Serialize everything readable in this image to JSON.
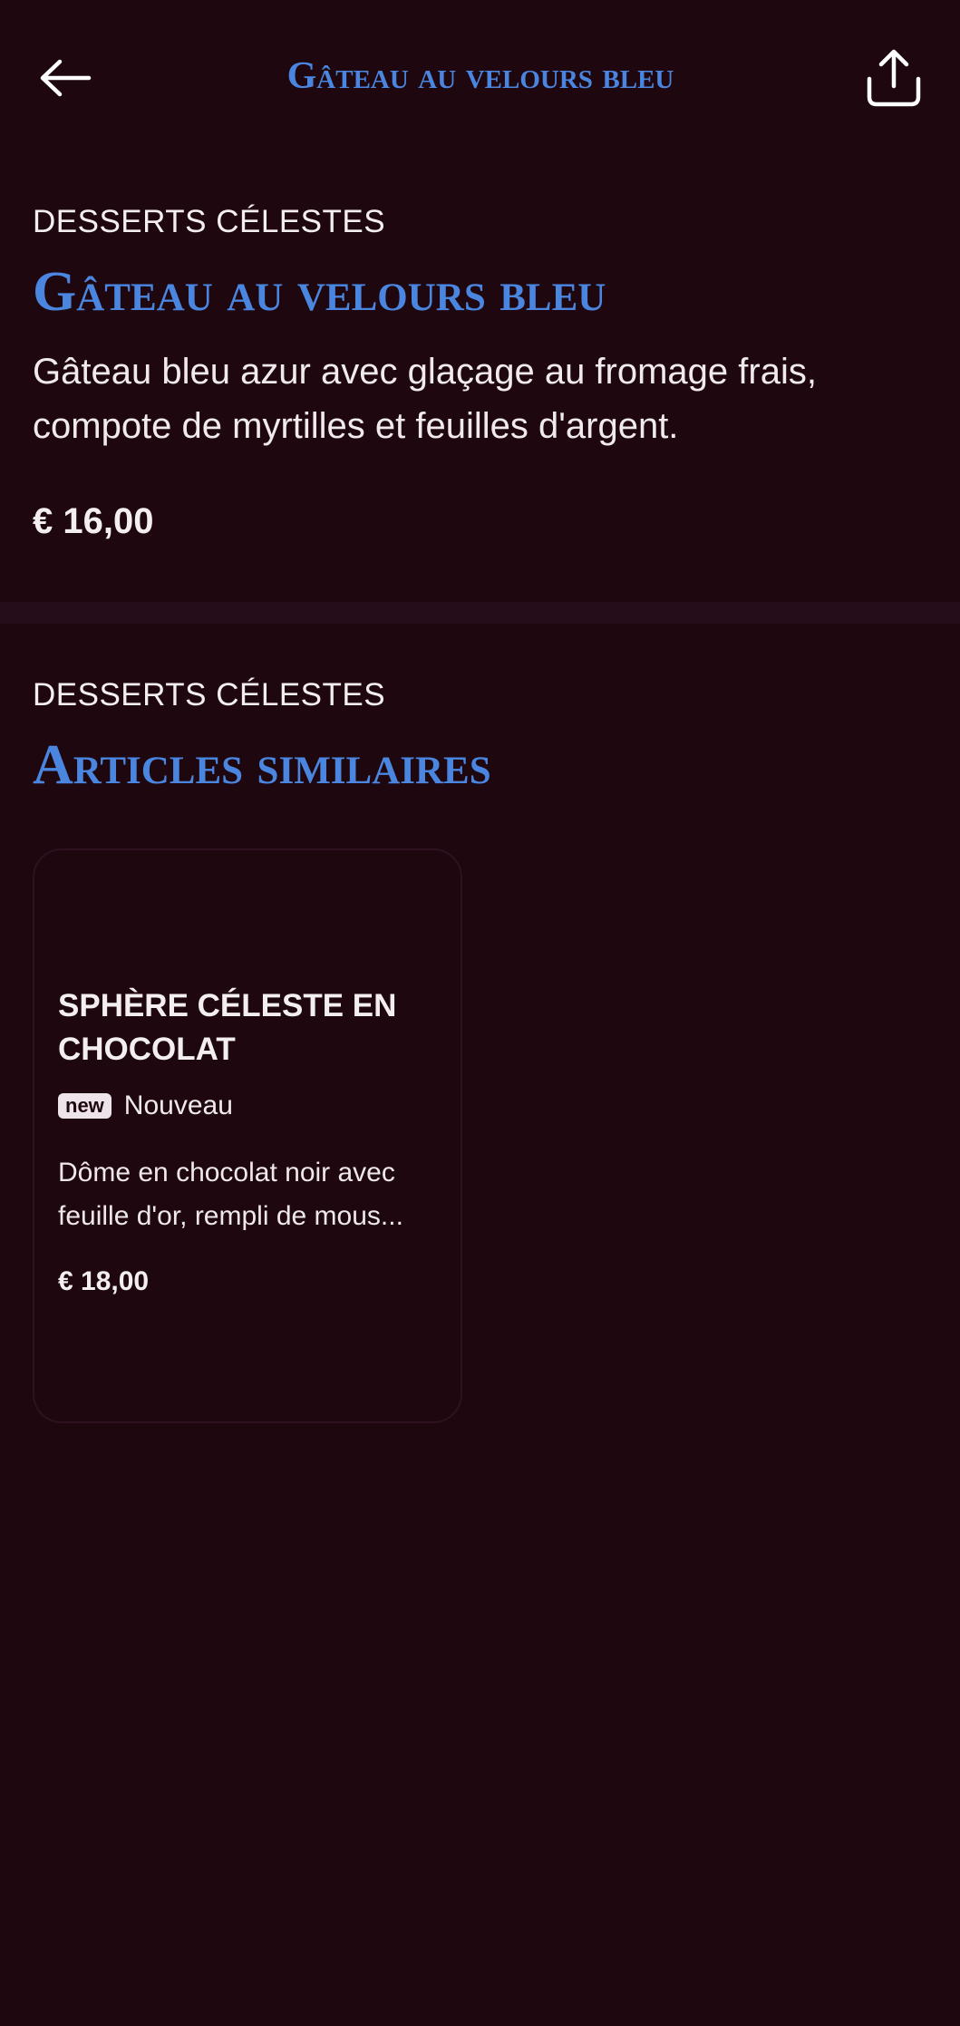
{
  "header": {
    "title": "Gâteau au velours bleu",
    "back_icon": "arrow-left-icon",
    "share_icon": "share-icon"
  },
  "product": {
    "category": "DESSERTS CÉLESTES",
    "name": "Gâteau au velours bleu",
    "description": "Gâteau bleu azur avec glaçage au fromage frais, compote de myrtilles et feuilles d'argent.",
    "price": "€ 16,00"
  },
  "related": {
    "category": "DESSERTS CÉLESTES",
    "title": "Articles similaires",
    "items": [
      {
        "name": "SPHÈRE CÉLESTE EN CHOCOLAT",
        "badge": "new",
        "badge_label": "Nouveau",
        "description": "Dôme en chocolat noir avec feuille d'or, rempli de mous...",
        "price": "€ 18,00"
      }
    ]
  },
  "colors": {
    "background": "#1f0710",
    "accent": "#4a86e0",
    "text": "#f3eef0"
  }
}
